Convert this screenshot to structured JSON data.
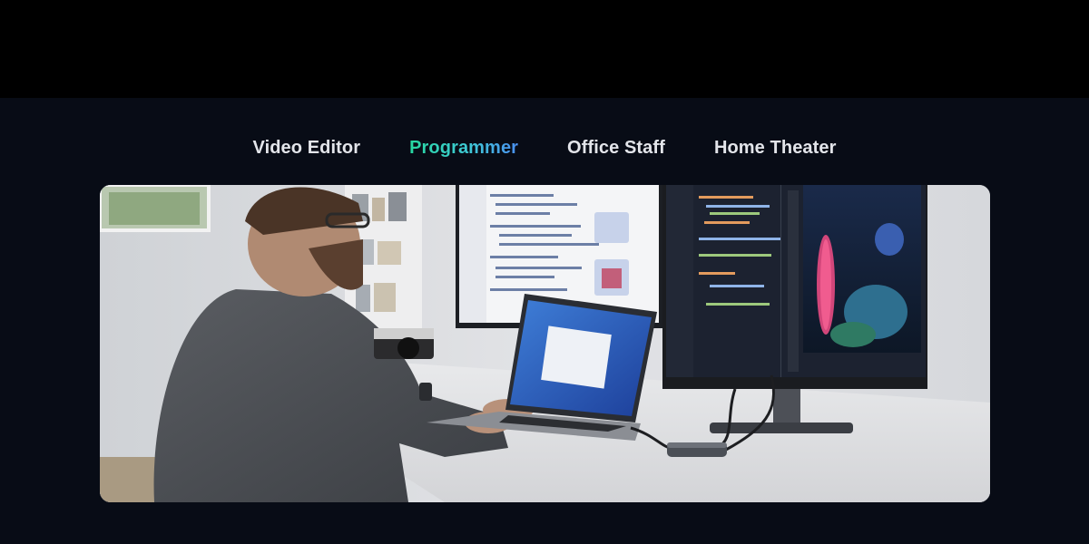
{
  "tabs": [
    {
      "label": "Video Editor",
      "active": false
    },
    {
      "label": "Programmer",
      "active": true
    },
    {
      "label": "Office Staff",
      "active": false
    },
    {
      "label": "Home Theater",
      "active": false
    }
  ],
  "colors": {
    "page_background": "#080c16",
    "top_band": "#000000",
    "tab_text": "#e3e5ea",
    "active_gradient_start": "#27d7a0",
    "active_gradient_end": "#4a8ff0"
  },
  "photo": {
    "scene": "programmer-desk-with-laptop-dual-monitors-and-usb-hub"
  }
}
